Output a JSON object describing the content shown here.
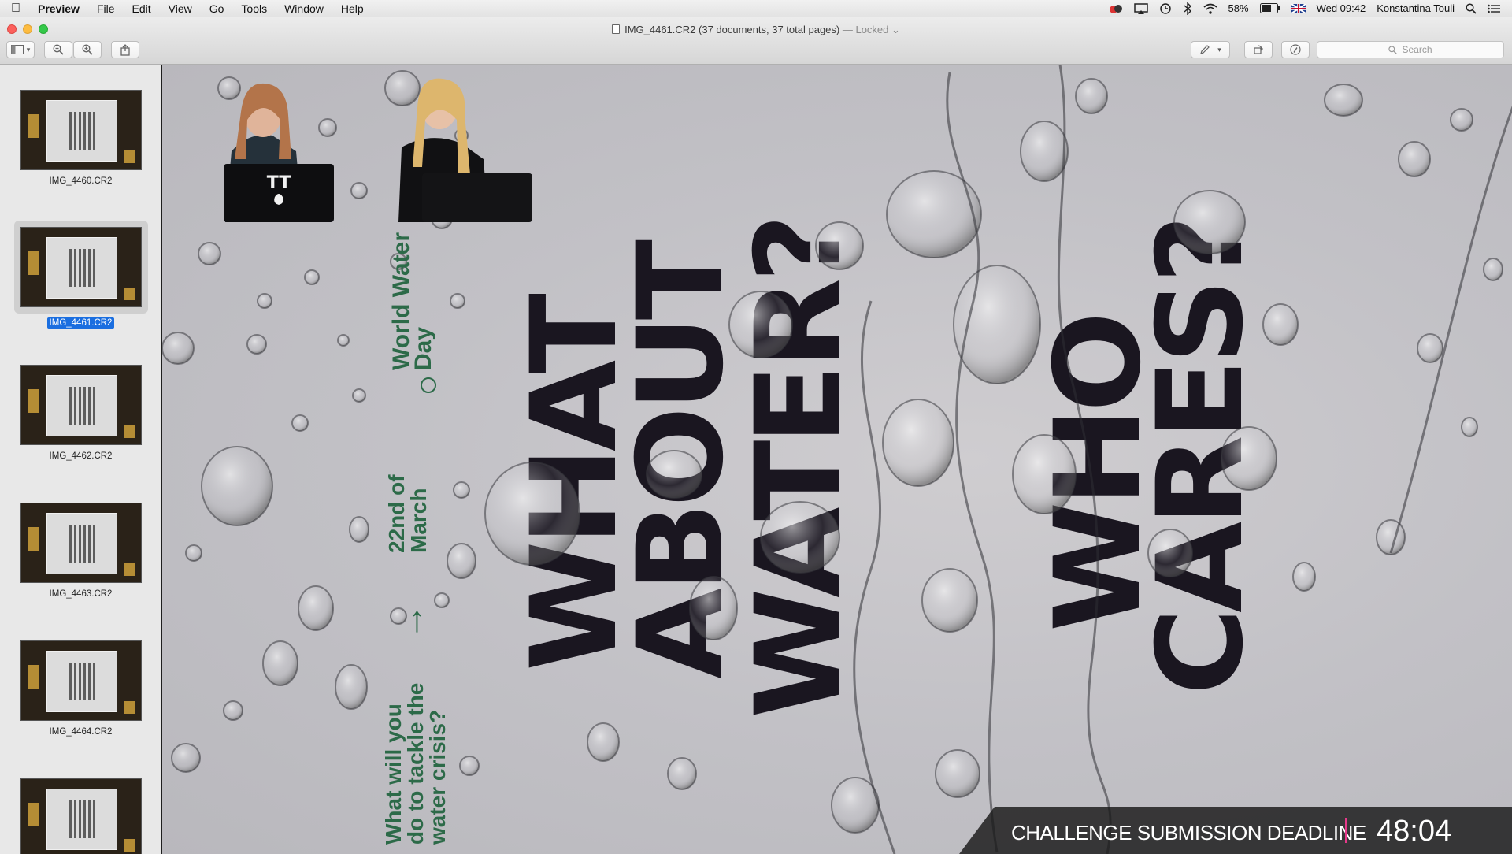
{
  "menubar": {
    "app_name": "Preview",
    "menus": [
      "File",
      "Edit",
      "View",
      "Go",
      "Tools",
      "Window",
      "Help"
    ],
    "battery_percent": "58%",
    "clock": "Wed 09:42",
    "user": "Konstantina Touli"
  },
  "window": {
    "title": "IMG_4461.CR2 (37 documents, 37 total pages)",
    "locked": "— Locked"
  },
  "toolbar": {
    "search_placeholder": "Search"
  },
  "sidebar": {
    "items": [
      {
        "label": "IMG_4460.CR2"
      },
      {
        "label": "IMG_4461.CR2",
        "selected": true
      },
      {
        "label": "IMG_4462.CR2"
      },
      {
        "label": "IMG_4463.CR2"
      },
      {
        "label": "IMG_4464.CR2"
      }
    ]
  },
  "poster": {
    "headline_lines": [
      "WHAT",
      "ABOUT",
      "WATER?",
      "WHO",
      "CARES?"
    ],
    "event": "World Water Day",
    "date": "22nd of March",
    "question": "What will you do to tackle the water crisis?",
    "arrow": "→"
  },
  "banner": {
    "label": "CHALLENGE SUBMISSION DEADLINE",
    "time": "48:04",
    "accent": "#e6398a"
  },
  "laptop_logo": "TT"
}
